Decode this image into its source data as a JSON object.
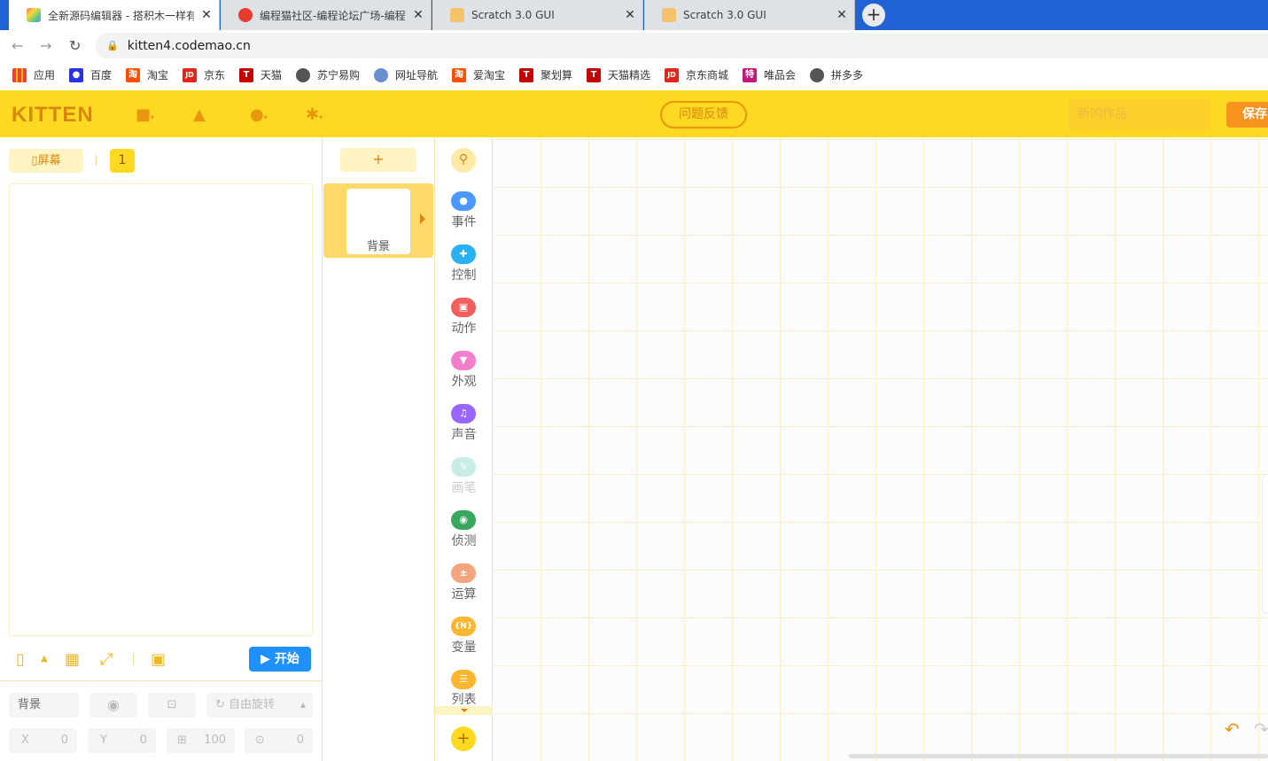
{
  "browser": {
    "tabs": [
      {
        "title": "全新源码编辑器 - 搭积木一样有趣",
        "active": true
      },
      {
        "title": "编程猫社区-编程论坛广场-编程猫",
        "active": false
      },
      {
        "title": "Scratch 3.0 GUI",
        "active": false
      },
      {
        "title": "Scratch 3.0 GUI",
        "active": false
      }
    ],
    "new_tab": "+",
    "url": "kitten4.codemao.cn",
    "bookmarks": [
      {
        "label": "应用",
        "color": "#4285f4",
        "glyph": "⋮"
      },
      {
        "label": "百度",
        "color": "#2932e1",
        "glyph": "🐾"
      },
      {
        "label": "淘宝",
        "color": "#ff5000",
        "glyph": "淘"
      },
      {
        "label": "京东",
        "color": "#e1251b",
        "glyph": "JD"
      },
      {
        "label": "天猫",
        "color": "#c40000",
        "glyph": "T"
      },
      {
        "label": "苏宁易购",
        "color": "#555555",
        "glyph": "●"
      },
      {
        "label": "网址导航",
        "color": "#6a8fd1",
        "glyph": "◍"
      },
      {
        "label": "爱淘宝",
        "color": "#ff5000",
        "glyph": "淘"
      },
      {
        "label": "聚划算",
        "color": "#c40000",
        "glyph": "T"
      },
      {
        "label": "天猫精选",
        "color": "#c40000",
        "glyph": "T"
      },
      {
        "label": "京东商城",
        "color": "#e1251b",
        "glyph": "JD"
      },
      {
        "label": "唯品会",
        "color": "#c3187a",
        "glyph": "特"
      },
      {
        "label": "拼多多",
        "color": "#555555",
        "glyph": "●"
      }
    ]
  },
  "header": {
    "logo": "KITTEN",
    "feedback": "问题反馈",
    "project_name_placeholder": "新的作品",
    "save": "保存"
  },
  "stage": {
    "screen_label": "屏幕",
    "screen_number": "1",
    "start": "开始"
  },
  "properties": {
    "name": "背景",
    "rotate": "自由旋转",
    "x_label": "X",
    "x_value": "0",
    "y_label": "Y",
    "y_value": "0",
    "size_value": "100",
    "direction_value": "0"
  },
  "sprites": {
    "add": "+",
    "items": [
      {
        "label": "背景"
      }
    ]
  },
  "categories": [
    {
      "label": "事件",
      "color": "#4d97ff",
      "glyph": "●",
      "enabled": true
    },
    {
      "label": "控制",
      "color": "#29b0f0",
      "glyph": "✚",
      "enabled": true
    },
    {
      "label": "动作",
      "color": "#f05e5e",
      "glyph": "▣",
      "enabled": true
    },
    {
      "label": "外观",
      "color": "#f37ecb",
      "glyph": "▼",
      "enabled": true
    },
    {
      "label": "声音",
      "color": "#9966ff",
      "glyph": "♫",
      "enabled": true
    },
    {
      "label": "画笔",
      "color": "#a7e3d6",
      "glyph": "✎",
      "enabled": false
    },
    {
      "label": "侦测",
      "color": "#3aa55c",
      "glyph": "◉",
      "enabled": true
    },
    {
      "label": "运算",
      "color": "#f2a57f",
      "glyph": "±",
      "enabled": true
    },
    {
      "label": "变量",
      "color": "#fdb62f",
      "glyph": "{N}",
      "enabled": true
    },
    {
      "label": "列表",
      "color": "#fdb62f",
      "glyph": "☰",
      "enabled": true
    }
  ]
}
